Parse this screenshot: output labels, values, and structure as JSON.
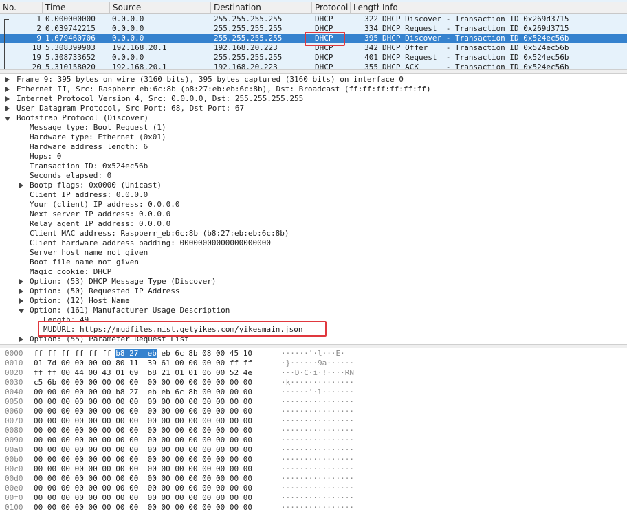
{
  "packet_list": {
    "columns": [
      "No.",
      "Time",
      "Source",
      "Destination",
      "Protocol",
      "Length",
      "Info"
    ],
    "rows": [
      {
        "no": "1",
        "time": "0.000000000",
        "src": "0.0.0.0",
        "dst": "255.255.255.255",
        "proto": "DHCP",
        "len": "322",
        "info": "DHCP Discover - Transaction ID 0x269d3715"
      },
      {
        "no": "2",
        "time": "0.039742215",
        "src": "0.0.0.0",
        "dst": "255.255.255.255",
        "proto": "DHCP",
        "len": "334",
        "info": "DHCP Request  - Transaction ID 0x269d3715"
      },
      {
        "no": "9",
        "time": "1.679460706",
        "src": "0.0.0.0",
        "dst": "255.255.255.255",
        "proto": "DHCP",
        "len": "395",
        "info": "DHCP Discover - Transaction ID 0x524ec56b"
      },
      {
        "no": "18",
        "time": "5.308399903",
        "src": "192.168.20.1",
        "dst": "192.168.20.223",
        "proto": "DHCP",
        "len": "342",
        "info": "DHCP Offer    - Transaction ID 0x524ec56b"
      },
      {
        "no": "19",
        "time": "5.308733652",
        "src": "0.0.0.0",
        "dst": "255.255.255.255",
        "proto": "DHCP",
        "len": "401",
        "info": "DHCP Request  - Transaction ID 0x524ec56b"
      },
      {
        "no": "20",
        "time": "5.310158020",
        "src": "192.168.20.1",
        "dst": "192.168.20.223",
        "proto": "DHCP",
        "len": "355",
        "info": "DHCP ACK      - Transaction ID 0x524ec56b"
      }
    ],
    "selected_no": "9"
  },
  "details": [
    {
      "text": "Frame 9: 395 bytes on wire (3160 bits), 395 bytes captured (3160 bits) on interface 0",
      "indent": 0,
      "expander": "closed"
    },
    {
      "text": "Ethernet II, Src: Raspberr_eb:6c:8b (b8:27:eb:eb:6c:8b), Dst: Broadcast (ff:ff:ff:ff:ff:ff)",
      "indent": 0,
      "expander": "closed"
    },
    {
      "text": "Internet Protocol Version 4, Src: 0.0.0.0, Dst: 255.255.255.255",
      "indent": 0,
      "expander": "closed"
    },
    {
      "text": "User Datagram Protocol, Src Port: 68, Dst Port: 67",
      "indent": 0,
      "expander": "closed"
    },
    {
      "text": "Bootstrap Protocol (Discover)",
      "indent": 0,
      "expander": "open"
    },
    {
      "text": "Message type: Boot Request (1)",
      "indent": 1,
      "expander": "none"
    },
    {
      "text": "Hardware type: Ethernet (0x01)",
      "indent": 1,
      "expander": "none"
    },
    {
      "text": "Hardware address length: 6",
      "indent": 1,
      "expander": "none"
    },
    {
      "text": "Hops: 0",
      "indent": 1,
      "expander": "none"
    },
    {
      "text": "Transaction ID: 0x524ec56b",
      "indent": 1,
      "expander": "none"
    },
    {
      "text": "Seconds elapsed: 0",
      "indent": 1,
      "expander": "none"
    },
    {
      "text": "Bootp flags: 0x0000 (Unicast)",
      "indent": 1,
      "expander": "closed"
    },
    {
      "text": "Client IP address: 0.0.0.0",
      "indent": 1,
      "expander": "none"
    },
    {
      "text": "Your (client) IP address: 0.0.0.0",
      "indent": 1,
      "expander": "none"
    },
    {
      "text": "Next server IP address: 0.0.0.0",
      "indent": 1,
      "expander": "none"
    },
    {
      "text": "Relay agent IP address: 0.0.0.0",
      "indent": 1,
      "expander": "none"
    },
    {
      "text": "Client MAC address: Raspberr_eb:6c:8b (b8:27:eb:eb:6c:8b)",
      "indent": 1,
      "expander": "none"
    },
    {
      "text": "Client hardware address padding: 00000000000000000000",
      "indent": 1,
      "expander": "none"
    },
    {
      "text": "Server host name not given",
      "indent": 1,
      "expander": "none"
    },
    {
      "text": "Boot file name not given",
      "indent": 1,
      "expander": "none"
    },
    {
      "text": "Magic cookie: DHCP",
      "indent": 1,
      "expander": "none"
    },
    {
      "text": "Option: (53) DHCP Message Type (Discover)",
      "indent": 1,
      "expander": "closed"
    },
    {
      "text": "Option: (50) Requested IP Address",
      "indent": 1,
      "expander": "closed"
    },
    {
      "text": "Option: (12) Host Name",
      "indent": 1,
      "expander": "closed"
    },
    {
      "text": "Option: (161) Manufacturer Usage Description",
      "indent": 1,
      "expander": "open"
    },
    {
      "text": "Length: 49",
      "indent": 2,
      "expander": "none"
    },
    {
      "text": "MUDURL: https://mudfiles.nist.getyikes.com/yikesmain.json",
      "indent": 2,
      "expander": "none"
    },
    {
      "text": "Option: (55) Parameter Request List",
      "indent": 1,
      "expander": "closed"
    }
  ],
  "bytes": [
    {
      "off": "0000",
      "hex": [
        "ff",
        "ff",
        "ff",
        "ff",
        "ff",
        "ff",
        "b8",
        "27",
        "eb",
        "eb",
        "6c",
        "8b",
        "08",
        "00",
        "45",
        "10"
      ],
      "ascii": "······'·l···E·",
      "hl": [
        6,
        7,
        8
      ]
    },
    {
      "off": "0010",
      "hex": [
        "01",
        "7d",
        "00",
        "00",
        "00",
        "00",
        "80",
        "11",
        "39",
        "61",
        "00",
        "00",
        "00",
        "00",
        "ff",
        "ff"
      ],
      "ascii": "·}······9a······",
      "hl": []
    },
    {
      "off": "0020",
      "hex": [
        "ff",
        "ff",
        "00",
        "44",
        "00",
        "43",
        "01",
        "69",
        "b8",
        "21",
        "01",
        "01",
        "06",
        "00",
        "52",
        "4e"
      ],
      "ascii": "···D·C·i·!····RN",
      "hl": []
    },
    {
      "off": "0030",
      "hex": [
        "c5",
        "6b",
        "00",
        "00",
        "00",
        "00",
        "00",
        "00",
        "00",
        "00",
        "00",
        "00",
        "00",
        "00",
        "00",
        "00"
      ],
      "ascii": "·k··············",
      "hl": []
    },
    {
      "off": "0040",
      "hex": [
        "00",
        "00",
        "00",
        "00",
        "00",
        "00",
        "b8",
        "27",
        "eb",
        "eb",
        "6c",
        "8b",
        "00",
        "00",
        "00",
        "00"
      ],
      "ascii": "······'·l·······",
      "hl": []
    },
    {
      "off": "0050",
      "hex": [
        "00",
        "00",
        "00",
        "00",
        "00",
        "00",
        "00",
        "00",
        "00",
        "00",
        "00",
        "00",
        "00",
        "00",
        "00",
        "00"
      ],
      "ascii": "················",
      "hl": []
    },
    {
      "off": "0060",
      "hex": [
        "00",
        "00",
        "00",
        "00",
        "00",
        "00",
        "00",
        "00",
        "00",
        "00",
        "00",
        "00",
        "00",
        "00",
        "00",
        "00"
      ],
      "ascii": "················",
      "hl": []
    },
    {
      "off": "0070",
      "hex": [
        "00",
        "00",
        "00",
        "00",
        "00",
        "00",
        "00",
        "00",
        "00",
        "00",
        "00",
        "00",
        "00",
        "00",
        "00",
        "00"
      ],
      "ascii": "················",
      "hl": []
    },
    {
      "off": "0080",
      "hex": [
        "00",
        "00",
        "00",
        "00",
        "00",
        "00",
        "00",
        "00",
        "00",
        "00",
        "00",
        "00",
        "00",
        "00",
        "00",
        "00"
      ],
      "ascii": "················",
      "hl": []
    },
    {
      "off": "0090",
      "hex": [
        "00",
        "00",
        "00",
        "00",
        "00",
        "00",
        "00",
        "00",
        "00",
        "00",
        "00",
        "00",
        "00",
        "00",
        "00",
        "00"
      ],
      "ascii": "················",
      "hl": []
    },
    {
      "off": "00a0",
      "hex": [
        "00",
        "00",
        "00",
        "00",
        "00",
        "00",
        "00",
        "00",
        "00",
        "00",
        "00",
        "00",
        "00",
        "00",
        "00",
        "00"
      ],
      "ascii": "················",
      "hl": []
    },
    {
      "off": "00b0",
      "hex": [
        "00",
        "00",
        "00",
        "00",
        "00",
        "00",
        "00",
        "00",
        "00",
        "00",
        "00",
        "00",
        "00",
        "00",
        "00",
        "00"
      ],
      "ascii": "················",
      "hl": []
    },
    {
      "off": "00c0",
      "hex": [
        "00",
        "00",
        "00",
        "00",
        "00",
        "00",
        "00",
        "00",
        "00",
        "00",
        "00",
        "00",
        "00",
        "00",
        "00",
        "00"
      ],
      "ascii": "················",
      "hl": []
    },
    {
      "off": "00d0",
      "hex": [
        "00",
        "00",
        "00",
        "00",
        "00",
        "00",
        "00",
        "00",
        "00",
        "00",
        "00",
        "00",
        "00",
        "00",
        "00",
        "00"
      ],
      "ascii": "················",
      "hl": []
    },
    {
      "off": "00e0",
      "hex": [
        "00",
        "00",
        "00",
        "00",
        "00",
        "00",
        "00",
        "00",
        "00",
        "00",
        "00",
        "00",
        "00",
        "00",
        "00",
        "00"
      ],
      "ascii": "················",
      "hl": []
    },
    {
      "off": "00f0",
      "hex": [
        "00",
        "00",
        "00",
        "00",
        "00",
        "00",
        "00",
        "00",
        "00",
        "00",
        "00",
        "00",
        "00",
        "00",
        "00",
        "00"
      ],
      "ascii": "················",
      "hl": []
    },
    {
      "off": "0100",
      "hex": [
        "00",
        "00",
        "00",
        "00",
        "00",
        "00",
        "00",
        "00",
        "00",
        "00",
        "00",
        "00",
        "00",
        "00",
        "00",
        "00"
      ],
      "ascii": "················",
      "hl": []
    }
  ],
  "colors": {
    "selection": "#3582ce",
    "list_bg": "#e6f2fb",
    "annotation": "#e0383e"
  }
}
